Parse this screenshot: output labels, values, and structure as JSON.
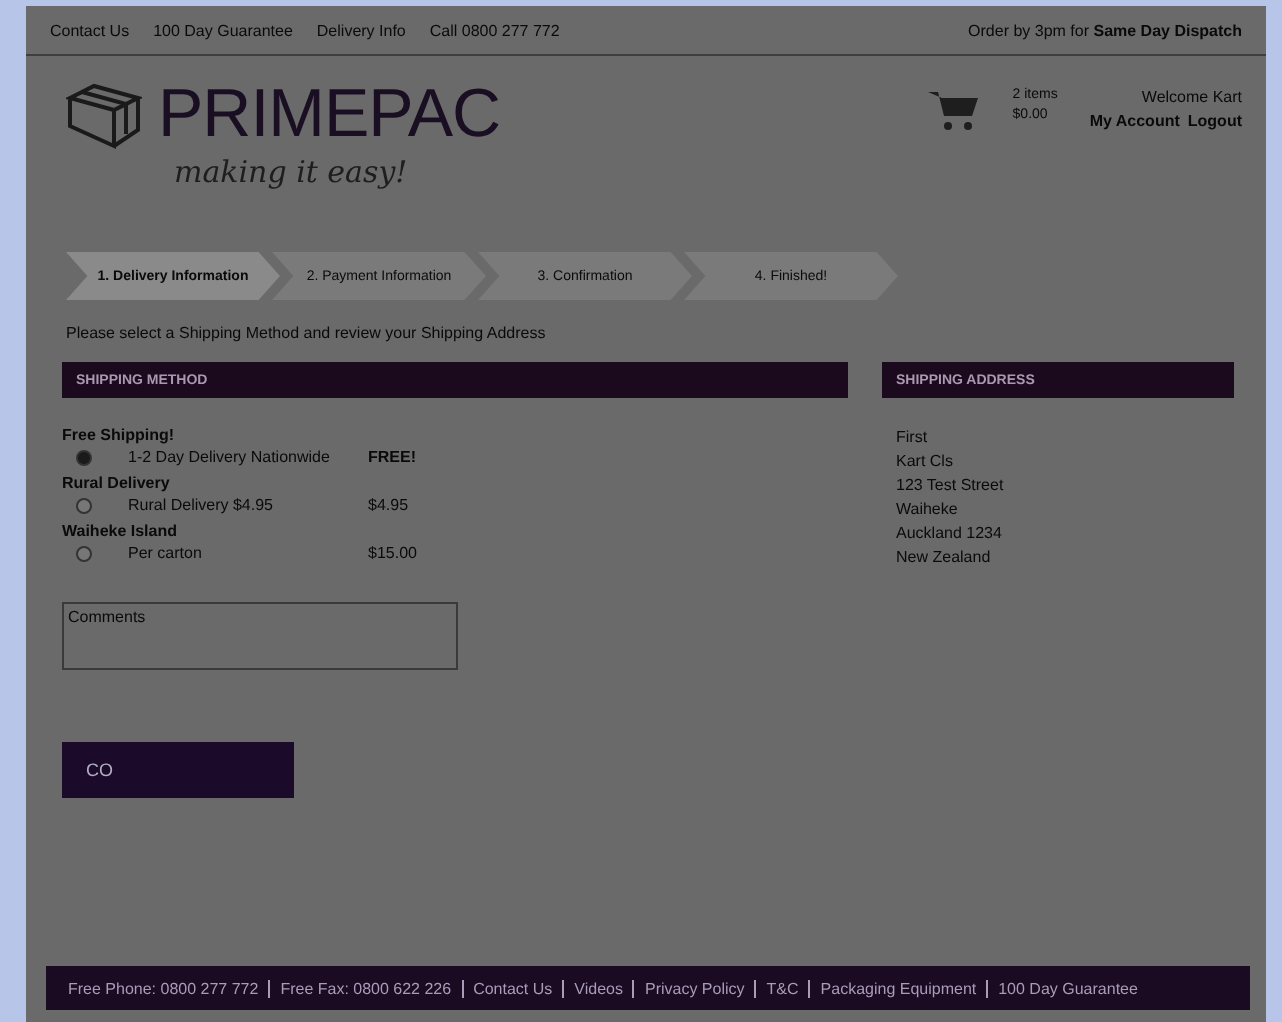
{
  "top_bar": {
    "links": [
      "Contact Us",
      "100 Day Guarantee",
      "Delivery Info",
      "Call 0800 277 772"
    ],
    "dispatch_note": "Order by 3pm for **Same Day Dispatch**"
  },
  "header": {
    "logo": "PRIMEPAC",
    "tagline": "making it easy!",
    "cart": {
      "items": "2 items",
      "total": "$0.00"
    },
    "welcome": "Welcome Kart",
    "account_links": [
      "My Account",
      "Logout"
    ]
  },
  "steps": [
    {
      "label": "1. Delivery Information",
      "selected": true
    },
    {
      "label": "2. Payment Information",
      "selected": false
    },
    {
      "label": "3. Confirmation",
      "selected": false
    },
    {
      "label": "4. Finished!",
      "selected": false
    }
  ],
  "instruction": "Please select a Shipping Method and review your Shipping Address",
  "shipping_method": {
    "title": "SHIPPING METHOD",
    "groups": [
      {
        "name": "Free Shipping!",
        "option": "1-2 Day Delivery Nationwide",
        "price": "FREE!",
        "selected": true
      },
      {
        "name": "Rural Delivery",
        "option": "Rural Delivery $4.95",
        "price": "$4.95",
        "selected": false
      },
      {
        "name": "Waiheke Island",
        "option": "Per carton",
        "price": "$15.00",
        "selected": false
      }
    ],
    "comments": {
      "placeholder": "Comments"
    },
    "button": "CO"
  },
  "shipping_address": {
    "title": "SHIPPING ADDRESS",
    "lines": [
      "First",
      "Kart Cls",
      "123 Test Street",
      "Waiheke",
      "Auckland 1234",
      "New Zealand"
    ]
  },
  "footer": [
    "Free Phone: 0800 277 772",
    "Free Fax: 0800 622 226",
    "Contact Us",
    "Videos",
    "Privacy Policy",
    "T&C",
    "Packaging Equipment",
    "100 Day Guarantee"
  ]
}
